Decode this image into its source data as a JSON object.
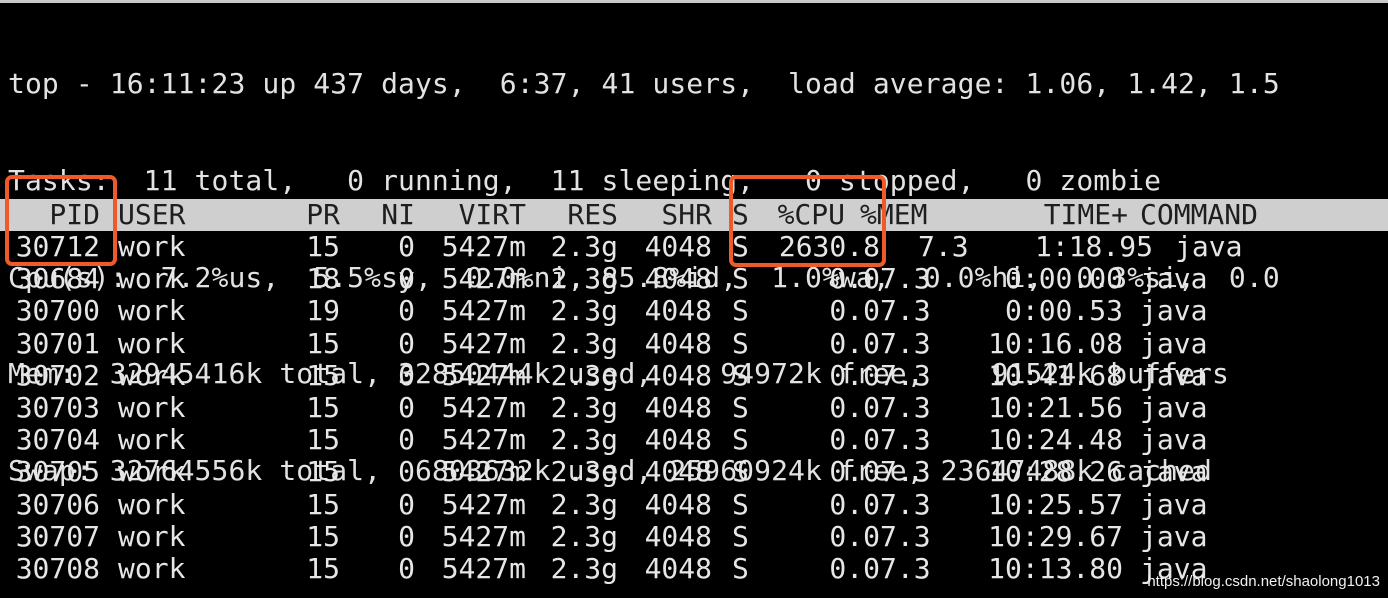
{
  "summary": {
    "line1": "top - 16:11:23 up 437 days,  6:37, 41 users,  load average: 1.06, 1.42, 1.5",
    "line2": "Tasks:  11 total,   0 running,  11 sleeping,   0 stopped,   0 zombie",
    "line3": "Cpu(s):  7.2%us,  5.5%sy,  0.0%ni, 85.8%id,  1.0%wa,  0.0%hi,  0.3%si,  0.0",
    "line4": "Mem:  32945416k total, 32850444k used,    94972k free,    91524k buffers",
    "line5": "Swap: 32764556k total,  6803632k used, 25960924k free, 23647488k cached"
  },
  "columns": {
    "pid": "PID",
    "user": "USER",
    "pr": "PR",
    "ni": "NI",
    "virt": "VIRT",
    "res": "RES",
    "shr": "SHR",
    "s": "S",
    "cpu": "%CPU",
    "mem": "%MEM",
    "time": "TIME+",
    "command": "COMMAND"
  },
  "processes": [
    {
      "pid": "30712",
      "user": "work",
      "pr": "15",
      "ni": "0",
      "virt": "5427m",
      "res": "2.3g",
      "shr": "4048",
      "s": "S",
      "cpu": "2630.8",
      "mem": "7.3",
      "time": "1:18.95",
      "command": "java"
    },
    {
      "pid": "30684",
      "user": "work",
      "pr": "18",
      "ni": "0",
      "virt": "5427m",
      "res": "2.3g",
      "shr": "4048",
      "s": "S",
      "cpu": "0.0",
      "mem": "7.3",
      "time": "0:00.00",
      "command": "java"
    },
    {
      "pid": "30700",
      "user": "work",
      "pr": "19",
      "ni": "0",
      "virt": "5427m",
      "res": "2.3g",
      "shr": "4048",
      "s": "S",
      "cpu": "0.0",
      "mem": "7.3",
      "time": "0:00.53",
      "command": "java"
    },
    {
      "pid": "30701",
      "user": "work",
      "pr": "15",
      "ni": "0",
      "virt": "5427m",
      "res": "2.3g",
      "shr": "4048",
      "s": "S",
      "cpu": "0.0",
      "mem": "7.3",
      "time": "10:16.08",
      "command": "java"
    },
    {
      "pid": "30702",
      "user": "work",
      "pr": "15",
      "ni": "0",
      "virt": "5427m",
      "res": "2.3g",
      "shr": "4048",
      "s": "S",
      "cpu": "0.0",
      "mem": "7.3",
      "time": "10:41.68",
      "command": "java"
    },
    {
      "pid": "30703",
      "user": "work",
      "pr": "15",
      "ni": "0",
      "virt": "5427m",
      "res": "2.3g",
      "shr": "4048",
      "s": "S",
      "cpu": "0.0",
      "mem": "7.3",
      "time": "10:21.56",
      "command": "java"
    },
    {
      "pid": "30704",
      "user": "work",
      "pr": "15",
      "ni": "0",
      "virt": "5427m",
      "res": "2.3g",
      "shr": "4048",
      "s": "S",
      "cpu": "0.0",
      "mem": "7.3",
      "time": "10:24.48",
      "command": "java"
    },
    {
      "pid": "30705",
      "user": "work",
      "pr": "15",
      "ni": "0",
      "virt": "5427m",
      "res": "2.3g",
      "shr": "4048",
      "s": "S",
      "cpu": "0.0",
      "mem": "7.3",
      "time": "10:28.26",
      "command": "java"
    },
    {
      "pid": "30706",
      "user": "work",
      "pr": "15",
      "ni": "0",
      "virt": "5427m",
      "res": "2.3g",
      "shr": "4048",
      "s": "S",
      "cpu": "0.0",
      "mem": "7.3",
      "time": "10:25.57",
      "command": "java"
    },
    {
      "pid": "30707",
      "user": "work",
      "pr": "15",
      "ni": "0",
      "virt": "5427m",
      "res": "2.3g",
      "shr": "4048",
      "s": "S",
      "cpu": "0.0",
      "mem": "7.3",
      "time": "10:29.67",
      "command": "java"
    },
    {
      "pid": "30708",
      "user": "work",
      "pr": "15",
      "ni": "0",
      "virt": "5427m",
      "res": "2.3g",
      "shr": "4048",
      "s": "S",
      "cpu": "0.0",
      "mem": "7.3",
      "time": "10:13.80",
      "command": "java"
    }
  ],
  "watermark": "https://blog.csdn.net/shaolong1013",
  "colors": {
    "background": "#000000",
    "text": "#d8d8d8",
    "header_bar": "#cfcfcf",
    "highlight": "#f05a2a"
  }
}
